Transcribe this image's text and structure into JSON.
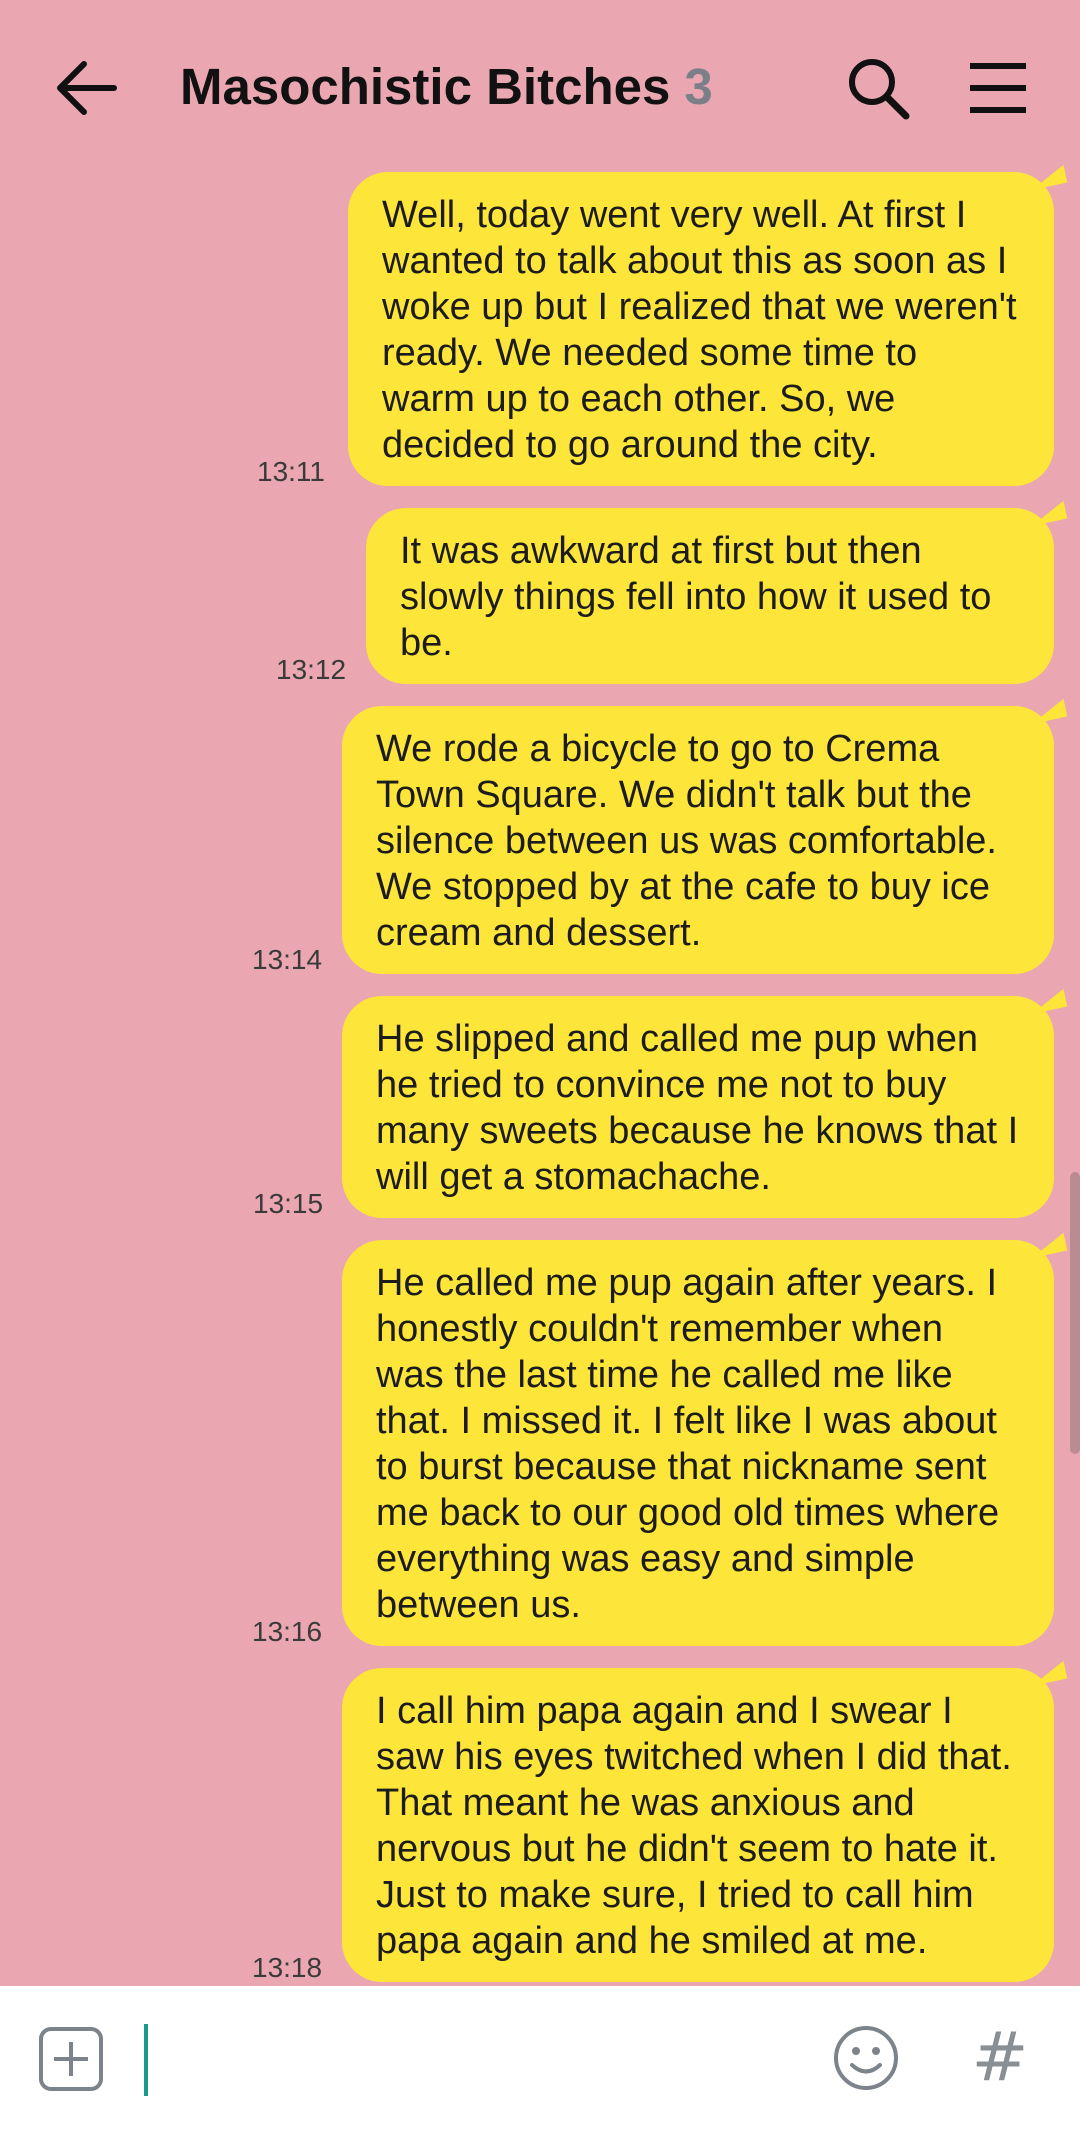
{
  "header": {
    "title": "Masochistic Bitches",
    "member_count": "3",
    "back_icon": "back-arrow-icon",
    "search_icon": "search-icon",
    "menu_icon": "hamburger-menu-icon"
  },
  "colors": {
    "background": "#eba7b1",
    "bubble": "#fde53a",
    "input_bar": "#ffffff",
    "caret": "#1a9a8a"
  },
  "messages": [
    {
      "time": "13:11",
      "text": "Well, today went very well. At first I wanted to talk about this as soon as I woke up but I realized that we weren't ready. We needed some time to warm up to each other. So, we decided to go around the city."
    },
    {
      "time": "13:12",
      "text": "It was awkward at first but then slowly things fell into how it used to be."
    },
    {
      "time": "13:14",
      "text": "We rode a bicycle to go to Crema Town Square. We didn't talk but the silence between us was comfortable. We stopped by at the cafe to buy ice cream and dessert."
    },
    {
      "time": "13:15",
      "text": "He slipped and called me pup when he tried to convince me not to buy many sweets because he knows that I will get a stomachache."
    },
    {
      "time": "13:16",
      "text": "He called me pup again after years. I honestly couldn't remember when was the last time he called me like that. I missed it. I felt like I was about to burst because that nickname sent me back to our good old times where everything was easy and simple between us."
    },
    {
      "time": "13:18",
      "text": "I call him papa again and I swear I saw his eyes twitched when I did that. That meant he was anxious and nervous but he didn't seem to hate it. Just to make sure, I tried to call him papa again and he smiled at me."
    }
  ],
  "input_bar": {
    "value": "",
    "plus_icon": "plus-square-icon",
    "emoji_icon": "emoji-icon",
    "hashtag_label": "#"
  }
}
